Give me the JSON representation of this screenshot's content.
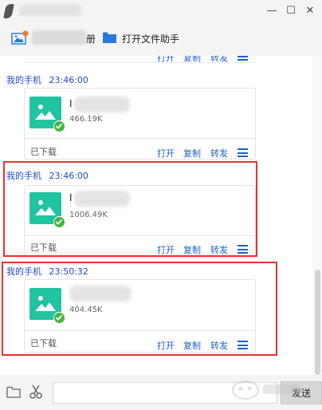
{
  "titlebar": {
    "minimize_symbol": "—",
    "maximize_symbol": "☐",
    "close_symbol": "✕"
  },
  "toolbar": {
    "upload_partial_text": "册",
    "open_assistant_label": "打开文件助手"
  },
  "chat": {
    "top_partial_actions": {
      "open": "打开",
      "copy": "复制",
      "forward": "转发"
    },
    "messages": [
      {
        "sender": "我的手机",
        "time": "23:46:00",
        "file_name_visible": "I",
        "file_size": "466.19K",
        "status": "已下载",
        "actions": {
          "open": "打开",
          "copy": "复制",
          "forward": "转发"
        }
      },
      {
        "sender": "我的手机",
        "time": "23:46:00",
        "file_name_visible": "I",
        "file_size": "1006.49K",
        "status": "已下载",
        "actions": {
          "open": "打开",
          "copy": "复制",
          "forward": "转发"
        }
      },
      {
        "sender": "我的手机",
        "time": "23:50:32",
        "file_name_visible": "",
        "file_size": "404.45K",
        "status": "已下载",
        "actions": {
          "open": "打开",
          "copy": "复制",
          "forward": "转发"
        }
      }
    ]
  },
  "inputbar": {
    "input_value": "",
    "send_label": "发送"
  },
  "icons": {
    "file": "image-file-icon",
    "downloaded": "check-icon",
    "more": "menu-icon",
    "folder": "folder-icon",
    "scissors": "scissors-icon",
    "upload": "upload-image-icon"
  },
  "colors": {
    "link_blue": "#1a62c8",
    "sender_blue": "#1f4ad6",
    "file_icon_teal": "#20c4a0",
    "check_green": "#46b443",
    "highlight_red": "#e8322e"
  }
}
